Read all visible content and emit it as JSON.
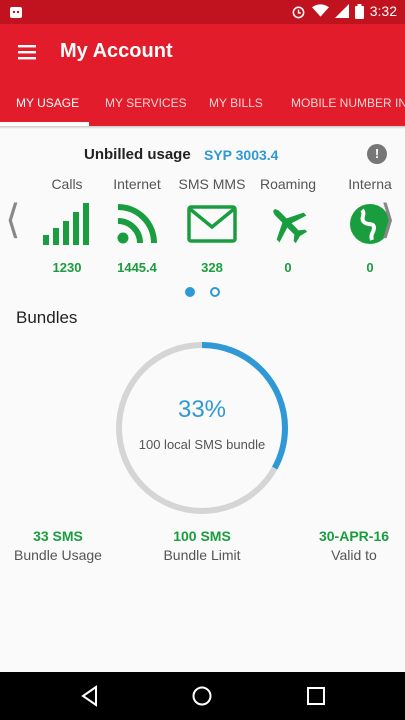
{
  "status_bar": {
    "time": "3:32"
  },
  "app_bar": {
    "title": "My Account",
    "color": "#e21c2a"
  },
  "tabs": [
    {
      "label": "MY USAGE",
      "selected": true
    },
    {
      "label": "MY SERVICES"
    },
    {
      "label": "MY BILLS"
    },
    {
      "label": "MOBILE NUMBER INF"
    }
  ],
  "unbilled": {
    "label": "Unbilled usage",
    "amount": "SYP 3003.4"
  },
  "info_button": {
    "glyph": "!"
  },
  "usage_items": [
    {
      "name": "Calls",
      "value": "1230",
      "icon": "signal-bars-icon"
    },
    {
      "name": "Internet",
      "value": "1445.4",
      "icon": "rss-icon"
    },
    {
      "name": "SMS MMS",
      "value": "328",
      "icon": "envelope-icon"
    },
    {
      "name": "Roaming",
      "value": "0",
      "icon": "airplane-icon"
    },
    {
      "name": "Interna",
      "value": "0",
      "icon": "globe-icon"
    }
  ],
  "carousel": {
    "arrow_left": "⟨",
    "arrow_right": "⟩",
    "page": 1,
    "pages": 2
  },
  "bundles": {
    "title": "Bundles",
    "percent_text": "33%",
    "progress": 0.33,
    "bundle_name": "100 local SMS bundle",
    "stats": [
      {
        "value": "33 SMS",
        "label": "Bundle Usage"
      },
      {
        "value": "100 SMS",
        "label": "Bundle Limit"
      },
      {
        "value": "30-APR-16",
        "label": "Valid to"
      }
    ]
  },
  "colors": {
    "green": "#1a9d3f",
    "blue": "#2f98d6",
    "red": "#e21c2a"
  }
}
